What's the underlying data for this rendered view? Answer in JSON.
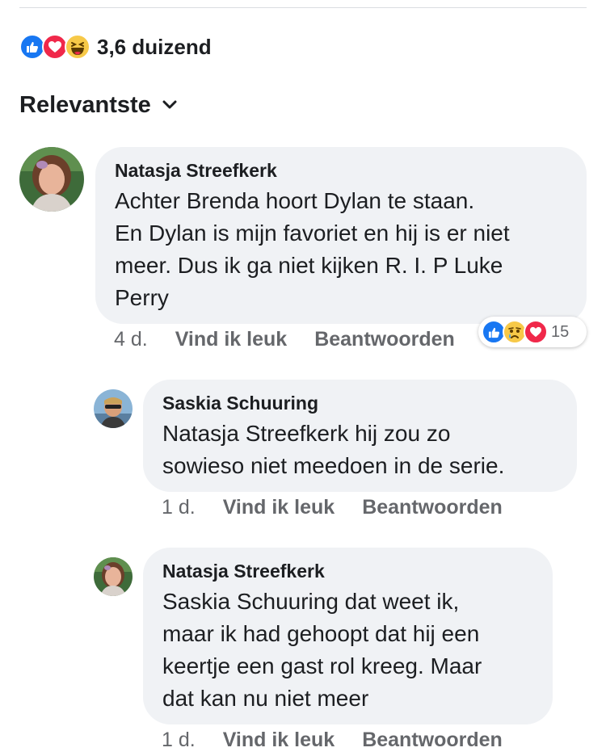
{
  "reactions": {
    "count_label": "3,6 duizend",
    "icons": [
      "like-icon",
      "love-icon",
      "haha-icon"
    ],
    "colors": {
      "like": "#1877f2",
      "love": "#f0284a",
      "haha": "#f7c948"
    }
  },
  "sort": {
    "label": "Relevantste",
    "icon": "chevron-down-icon"
  },
  "comments": [
    {
      "author": "Natasja Streefkerk",
      "text": [
        "Achter Brenda hoort Dylan te staan.",
        "En Dylan is mijn favoriet en hij is er niet",
        "meer. Dus ik ga niet kijken R. I. P Luke",
        "Perry"
      ],
      "time": "4 d.",
      "like_label": "Vind ik leuk",
      "reply_label": "Beantwoorden",
      "reaction_count": "15",
      "reaction_icons": [
        "like-icon",
        "sad-icon",
        "love-icon"
      ],
      "replies": [
        {
          "author": "Saskia Schuuring",
          "text": [
            "Natasja Streefkerk hij zou zo",
            "sowieso niet meedoen in de serie."
          ],
          "time": "1 d.",
          "like_label": "Vind ik leuk",
          "reply_label": "Beantwoorden"
        },
        {
          "author": "Natasja Streefkerk",
          "text": [
            "Saskia Schuuring dat weet ik,",
            "maar ik had gehoopt dat hij een",
            "keertje een gast rol kreeg. Maar",
            "dat kan nu niet meer"
          ],
          "time": "1 d.",
          "like_label": "Vind ik leuk",
          "reply_label": "Beantwoorden"
        }
      ]
    }
  ]
}
